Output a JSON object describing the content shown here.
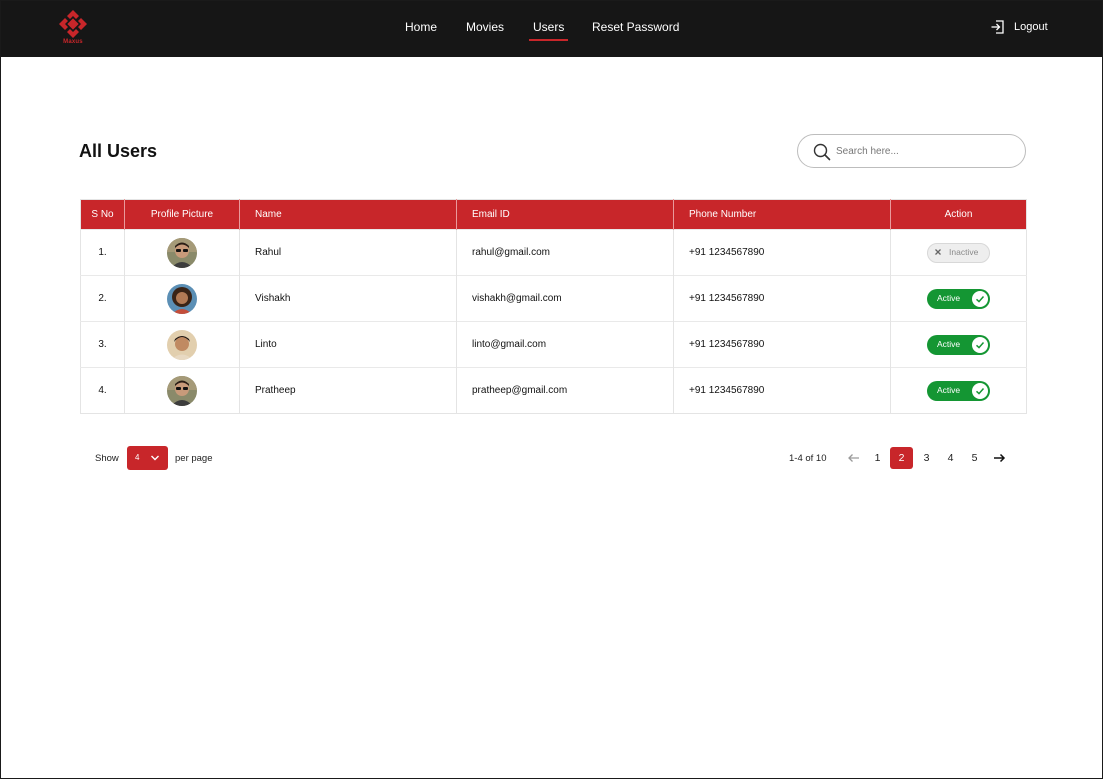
{
  "brand": {
    "name": "Maxus"
  },
  "nav": {
    "items": [
      {
        "label": "Home",
        "active": false
      },
      {
        "label": "Movies",
        "active": false
      },
      {
        "label": "Users",
        "active": true
      },
      {
        "label": "Reset Password",
        "active": false
      }
    ],
    "logout_label": "Logout"
  },
  "page": {
    "title": "All Users",
    "search_placeholder": "Search here..."
  },
  "table": {
    "columns": [
      "S No",
      "Profile Picture",
      "Name",
      "Email ID",
      "Phone Number",
      "Action"
    ],
    "rows": [
      {
        "sno": "1.",
        "name": "Rahul",
        "email": "rahul@gmail.com",
        "phone": "+91 1234567890",
        "status": "Inactive",
        "active": false,
        "avatar_icon": "avatar-icon"
      },
      {
        "sno": "2.",
        "name": "Vishakh",
        "email": "vishakh@gmail.com",
        "phone": "+91 1234567890",
        "status": "Active",
        "active": true,
        "avatar_icon": "avatar-icon"
      },
      {
        "sno": "3.",
        "name": "Linto",
        "email": "linto@gmail.com",
        "phone": "+91 1234567890",
        "status": "Active",
        "active": true,
        "avatar_icon": "avatar-icon"
      },
      {
        "sno": "4.",
        "name": "Pratheep",
        "email": "pratheep@gmail.com",
        "phone": "+91 1234567890",
        "status": "Active",
        "active": true,
        "avatar_icon": "avatar-icon"
      }
    ]
  },
  "pagination": {
    "show_label": "Show",
    "per_page_value": "4",
    "per_page_label": "per page",
    "range_text": "1-4 of 10",
    "pages": [
      "1",
      "2",
      "3",
      "4",
      "5"
    ],
    "current_page": "2"
  },
  "colors": {
    "accent": "#c8262a",
    "header_bg": "#161616",
    "active_green": "#149633"
  }
}
